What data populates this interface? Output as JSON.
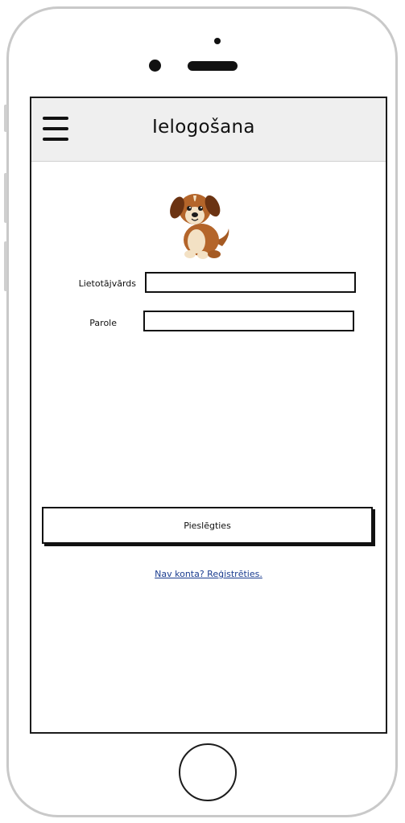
{
  "header": {
    "title": "Ielogošana"
  },
  "icons": {
    "menu": "hamburger-icon",
    "mascot": "dog-illustration"
  },
  "form": {
    "username_label": "Lietotājvārds",
    "username_value": "",
    "password_label": "Parole",
    "password_value": ""
  },
  "actions": {
    "login_label": "Pieslēgties",
    "register_link": "Nav konta? Reģistrēties."
  },
  "colors": {
    "appbar": "#efefef",
    "link": "#1a3c8f",
    "border": "#111111"
  }
}
